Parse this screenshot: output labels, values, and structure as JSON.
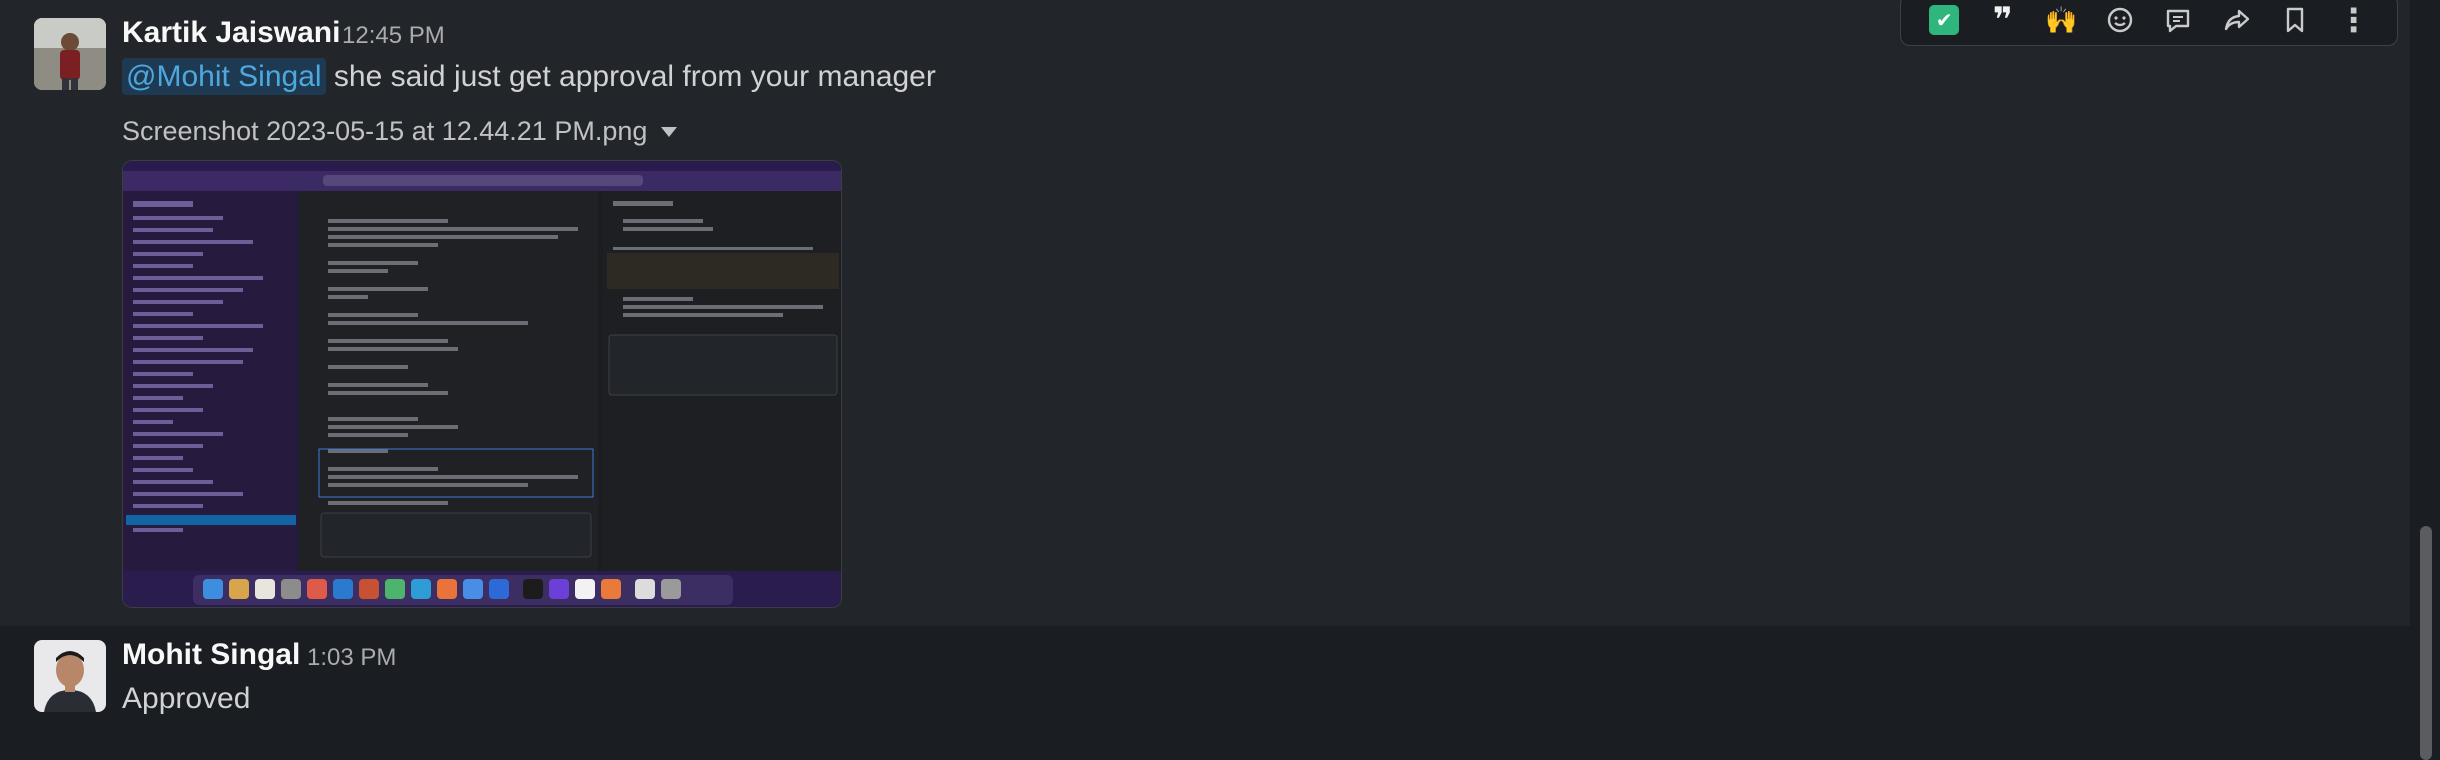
{
  "messages": [
    {
      "author": "Kartik Jaiswani",
      "time": "12:45 PM",
      "mention": "@Mohit Singal",
      "text": " she said just get approval from your manager",
      "attachment": {
        "filename": "Screenshot 2023-05-15 at 12.44.21 PM.png"
      }
    },
    {
      "author": "Mohit Singal",
      "time": "1:03 PM",
      "text": "Approved"
    }
  ],
  "toolbar": {
    "icons": [
      "check-reaction-icon",
      "quote-reaction-icon",
      "raised-hands-reaction-icon",
      "add-emoji-icon",
      "reply-thread-icon",
      "share-icon",
      "bookmark-icon",
      "more-options-icon"
    ],
    "check_glyph": "✔",
    "quote_glyph": "❞",
    "hands_glyph": "🙌",
    "more_glyph": "⋮"
  },
  "colors": {
    "background": "#1a1d21",
    "hover": "#222529",
    "mention_bg": "#1d3a52",
    "mention_text": "#4ea8de",
    "check_green": "#2eb67d"
  }
}
